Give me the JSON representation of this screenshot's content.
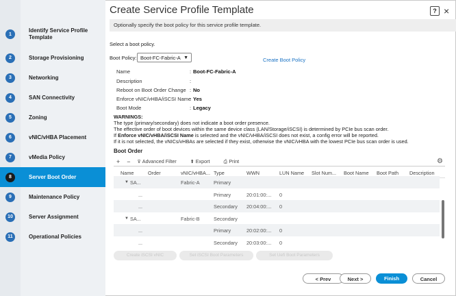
{
  "steps": [
    {
      "num": "1",
      "label": "Identify Service Profile\nTemplate"
    },
    {
      "num": "2",
      "label": "Storage Provisioning"
    },
    {
      "num": "3",
      "label": "Networking"
    },
    {
      "num": "4",
      "label": "SAN Connectivity"
    },
    {
      "num": "5",
      "label": "Zoning"
    },
    {
      "num": "6",
      "label": "vNIC/vHBA Placement"
    },
    {
      "num": "7",
      "label": "vMedia Policy"
    },
    {
      "num": "8",
      "label": "Server Boot Order"
    },
    {
      "num": "9",
      "label": "Maintenance Policy"
    },
    {
      "num": "10",
      "label": "Server Assignment"
    },
    {
      "num": "11",
      "label": "Operational Policies"
    }
  ],
  "active_step": "8",
  "title": "Create Service Profile Template",
  "help_icon": "?",
  "close_icon": "×",
  "info": "Optionally specify the boot policy for this service profile template.",
  "select_prompt": "Select a boot policy.",
  "boot_policy_label": "Boot Policy:",
  "boot_policy_value": "Boot-FC-Fabric-A",
  "create_boot_policy": "Create Boot Policy",
  "details": [
    {
      "k": "Name",
      "v": "Boot-FC-Fabric-A"
    },
    {
      "k": "Description",
      "v": ""
    },
    {
      "k": "Reboot on Boot Order Change",
      "v": "No"
    },
    {
      "k": "Enforce vNIC/vHBA/iSCSI Name",
      "v": "Yes"
    },
    {
      "k": "Boot Mode",
      "v": "Legacy"
    }
  ],
  "warnings": {
    "title": "WARNINGS:",
    "l1": "The type (primary/secondary) does not indicate a boot order presence.",
    "l2": "The effective order of boot devices within the same device class (LAN/Storage/iSCSI) is determined by PCIe bus scan order.",
    "l3a": "If ",
    "l3b": "Enforce vNIC/vHBA/iSCSI Name",
    "l3c": " is selected and the vNIC/vHBA/iSCSI does not exist, a config error will be reported.",
    "l4": "If it is not selected, the vNICs/vHBAs are selected if they exist, otherwise the vNIC/vHBA with the lowest PCIe bus scan order is used."
  },
  "boot_order_title": "Boot Order",
  "toolbar": {
    "add": "+",
    "remove": "−",
    "filter": "Advanced Filter",
    "export": "Export",
    "print": "Print"
  },
  "columns": [
    "Name",
    "Order",
    "vNIC/vHBA...",
    "Type",
    "WWN",
    "LUN Name",
    "Slot Num...",
    "Boot Name",
    "Boot Path",
    "Description"
  ],
  "rows": [
    {
      "name": "SA...",
      "order": "",
      "vnic": "Fabric-A",
      "type": "Primary",
      "wwn": "",
      "lun": ""
    },
    {
      "name": "...",
      "order": "",
      "vnic": "",
      "type": "Primary",
      "wwn": "20:01:00:...",
      "lun": "0"
    },
    {
      "name": "...",
      "order": "",
      "vnic": "",
      "type": "Secondary",
      "wwn": "20:04:00:...",
      "lun": "0"
    },
    {
      "name": "SA...",
      "order": "",
      "vnic": "Fabric-B",
      "type": "Secondary",
      "wwn": "",
      "lun": ""
    },
    {
      "name": "...",
      "order": "",
      "vnic": "",
      "type": "Primary",
      "wwn": "20:02:00:...",
      "lun": "0"
    },
    {
      "name": "...",
      "order": "",
      "vnic": "",
      "type": "Secondary",
      "wwn": "20:03:00:...",
      "lun": "0"
    }
  ],
  "disabled_buttons": [
    "Create iSCSI vNIC",
    "Set iSCSI Boot Parameters",
    "Set Uefi Boot Parameters"
  ],
  "buttons": {
    "prev": "< Prev",
    "next": "Next >",
    "finish": "Finish",
    "cancel": "Cancel"
  }
}
